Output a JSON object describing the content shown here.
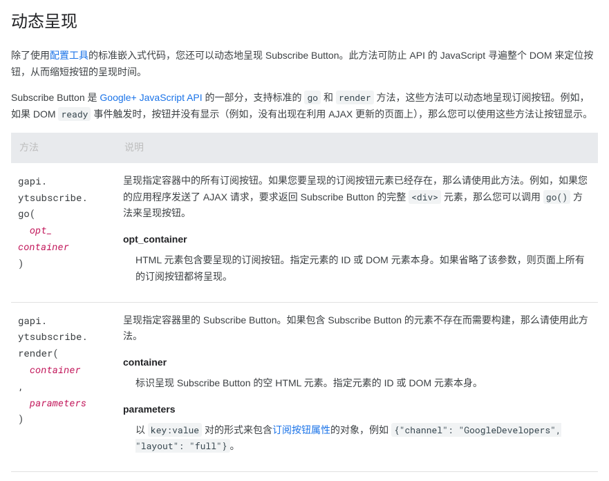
{
  "heading": "动态呈现",
  "intro1": {
    "p1a": "除了使用",
    "link1": "配置工具",
    "p1b": "的标准嵌入式代码，您还可以动态地呈现 Subscribe Button。此方法可防止 API 的 JavaScript 寻遍整个 DOM 来定位按钮，从而缩短按钮的呈现时间。"
  },
  "intro2": {
    "p2a": "Subscribe Button 是 ",
    "link2": "Google+ JavaScript API",
    "p2b": " 的一部分，支持标准的 ",
    "code_go": "go",
    "p2c": " 和 ",
    "code_render": "render",
    "p2d": " 方法，这些方法可以动态地呈现订阅按钮。例如，如果 DOM ",
    "code_ready": "ready",
    "p2e": " 事件触发时，按钮并没有显示（例如，没有出现在利用 AJAX 更新的页面上），那么您可以使用这些方法让按钮显示。"
  },
  "table": {
    "header_method": "方法",
    "header_desc": "说明",
    "rows": [
      {
        "sig_prefix": "gapi.\nytsubscribe.\ngo(\n  ",
        "sig_var": "opt_\ncontainer",
        "sig_suffix": "\n)",
        "lead_a": "呈现指定容器中的所有订阅按钮。如果您要呈现的订阅按钮元素已经存在，那么请使用此方法。例如，如果您的应用程序发送了 AJAX 请求，要求返回 Subscribe Button 的完整 ",
        "code_div": "<div>",
        "lead_b": " 元素，那么您可以调用 ",
        "code_gofn": "go()",
        "lead_c": " 方法来呈现按钮。",
        "param1_name": "opt_container",
        "param1_body": "HTML 元素包含要呈现的订阅按钮。指定元素的 ID 或 DOM 元素本身。如果省略了该参数，则页面上所有的订阅按钮都将呈现。"
      },
      {
        "sig_prefix": "gapi.\nytsubscribe.\nrender(\n  ",
        "sig_var": "container",
        "sig_mid": "\n,\n  ",
        "sig_var2": "parameters",
        "sig_suffix": "\n)",
        "lead_a": "呈现指定容器里的 Subscribe Button。如果包含 Subscribe Button 的元素不存在而需要构建，那么请使用此方法。",
        "param1_name": "container",
        "param1_body": "标识呈现 Subscribe Button 的空 HTML 元素。指定元素的 ID 或 DOM 元素本身。",
        "param2_name": "parameters",
        "param2_body_a": "以 ",
        "code_kv": "key:value",
        "param2_body_b": " 对的形式来包含",
        "link_attr": "订阅按钮属性",
        "param2_body_c": "的对象，例如 ",
        "code_ex": "{\"channel\": \"GoogleDevelopers\", \"layout\": \"full\"}",
        "param2_body_d": "。"
      }
    ]
  }
}
